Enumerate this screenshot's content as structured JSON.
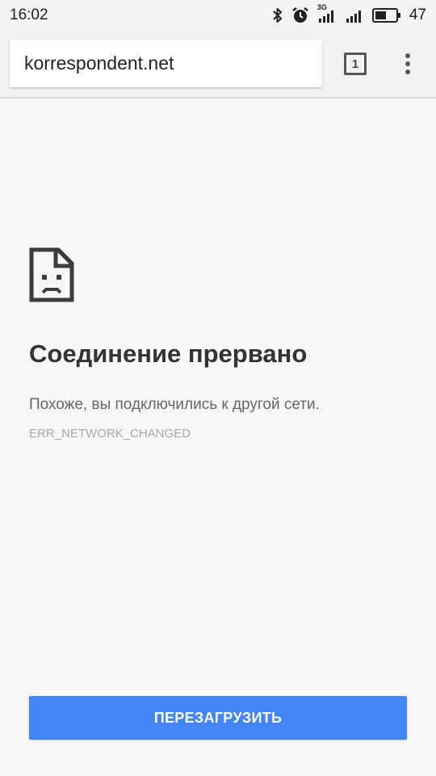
{
  "status_bar": {
    "time": "16:02",
    "network_label": "3G",
    "battery_percent": "47",
    "icons": [
      "bluetooth-icon",
      "alarm-icon",
      "signal-3g-icon",
      "signal-icon",
      "battery-icon"
    ]
  },
  "toolbar": {
    "url": "korrespondent.net",
    "tab_count": "1",
    "menu_icon": "more-vert-icon"
  },
  "error": {
    "icon": "sad-page-icon",
    "title": "Соединение прервано",
    "message": "Похоже, вы подключились к другой сети.",
    "code": "ERR_NETWORK_CHANGED"
  },
  "actions": {
    "reload_label": "ПЕРЕЗАГРУЗИТЬ"
  },
  "colors": {
    "accent": "#4285f4",
    "background": "#f7f7f7"
  }
}
